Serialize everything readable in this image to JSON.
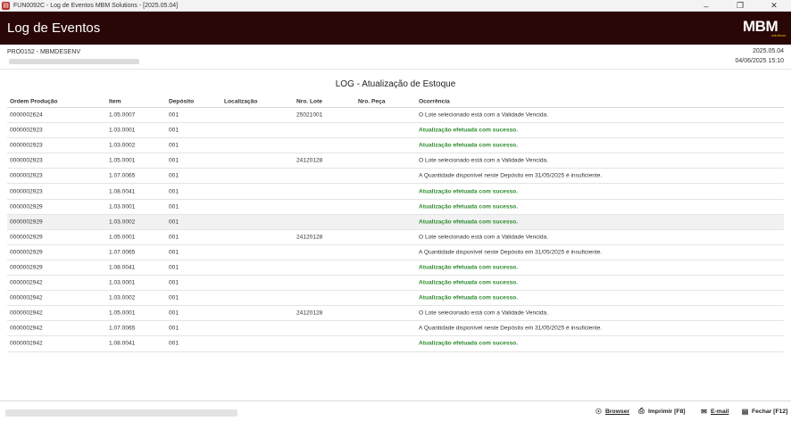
{
  "window": {
    "title": "FUN0092C - Log de Eventos MBM Solutions - [2025.05.04]",
    "icon": "app-icon",
    "controls": [
      "minimize",
      "maximize",
      "close"
    ]
  },
  "header": {
    "title": "Log de Eventos",
    "logo": "MBM",
    "logo_sub": "solutions",
    "bg_color": "#2a0707"
  },
  "info": {
    "program": "PRO0152 - MBMDESENV",
    "version": "2025.05.04",
    "datetime": "04/06/2025 15:10"
  },
  "report": {
    "title": "LOG - Atualização de Estoque"
  },
  "table": {
    "columns": {
      "ordem": "Ordem Produção",
      "item": "Item",
      "deposito": "Depósito",
      "localizacao": "Localização",
      "lote": "Nro. Lote",
      "peca": "Nro. Peça",
      "ocorrencia": "Ocorrência"
    },
    "rows": [
      {
        "ordem": "0000002624",
        "item": "1.05.0007",
        "deposito": "001",
        "localizacao": "",
        "lote": "25021001",
        "peca": "",
        "ocorrencia": "O Lote selecionado está com a Validade Vencida.",
        "status": "info"
      },
      {
        "ordem": "0000002923",
        "item": "1.03.0001",
        "deposito": "001",
        "localizacao": "",
        "lote": "",
        "peca": "",
        "ocorrencia": "Atualização efetuada com sucesso.",
        "status": "ok"
      },
      {
        "ordem": "0000002923",
        "item": "1.03.0002",
        "deposito": "001",
        "localizacao": "",
        "lote": "",
        "peca": "",
        "ocorrencia": "Atualização efetuada com sucesso.",
        "status": "ok"
      },
      {
        "ordem": "0000002923",
        "item": "1.05.0001",
        "deposito": "001",
        "localizacao": "",
        "lote": "24120128",
        "peca": "",
        "ocorrencia": "O Lote selecionado está com a Validade Vencida.",
        "status": "info"
      },
      {
        "ordem": "0000002923",
        "item": "1.07.0065",
        "deposito": "001",
        "localizacao": "",
        "lote": "",
        "peca": "",
        "ocorrencia": "A Quantidade disponível neste Depósito em 31/05/2025 é insuficiente.",
        "status": "info"
      },
      {
        "ordem": "0000002923",
        "item": "1.08.0041",
        "deposito": "001",
        "localizacao": "",
        "lote": "",
        "peca": "",
        "ocorrencia": "Atualização efetuada com sucesso.",
        "status": "ok"
      },
      {
        "ordem": "0000002929",
        "item": "1.03.0001",
        "deposito": "001",
        "localizacao": "",
        "lote": "",
        "peca": "",
        "ocorrencia": "Atualização efetuada com sucesso.",
        "status": "ok"
      },
      {
        "ordem": "0000002929",
        "item": "1.03.0002",
        "deposito": "001",
        "localizacao": "",
        "lote": "",
        "peca": "",
        "ocorrencia": "Atualização efetuada com sucesso.",
        "status": "ok",
        "highlight": true
      },
      {
        "ordem": "0000002929",
        "item": "1.05.0001",
        "deposito": "001",
        "localizacao": "",
        "lote": "24120128",
        "peca": "",
        "ocorrencia": "O Lote selecionado está com a Validade Vencida.",
        "status": "info"
      },
      {
        "ordem": "0000002929",
        "item": "1.07.0065",
        "deposito": "001",
        "localizacao": "",
        "lote": "",
        "peca": "",
        "ocorrencia": "A Quantidade disponível neste Depósito em 31/05/2025 é insuficiente.",
        "status": "info"
      },
      {
        "ordem": "0000002929",
        "item": "1.08.0041",
        "deposito": "001",
        "localizacao": "",
        "lote": "",
        "peca": "",
        "ocorrencia": "Atualização efetuada com sucesso.",
        "status": "ok"
      },
      {
        "ordem": "0000002942",
        "item": "1.03.0001",
        "deposito": "001",
        "localizacao": "",
        "lote": "",
        "peca": "",
        "ocorrencia": "Atualização efetuada com sucesso.",
        "status": "ok"
      },
      {
        "ordem": "0000002942",
        "item": "1.03.0002",
        "deposito": "001",
        "localizacao": "",
        "lote": "",
        "peca": "",
        "ocorrencia": "Atualização efetuada com sucesso.",
        "status": "ok"
      },
      {
        "ordem": "0000002942",
        "item": "1.05.0001",
        "deposito": "001",
        "localizacao": "",
        "lote": "24120128",
        "peca": "",
        "ocorrencia": "O Lote selecionado está com a Validade Vencida.",
        "status": "info"
      },
      {
        "ordem": "0000002942",
        "item": "1.07.0065",
        "deposito": "001",
        "localizacao": "",
        "lote": "",
        "peca": "",
        "ocorrencia": "A Quantidade disponível neste Depósito em 31/05/2025 é insuficiente.",
        "status": "info"
      },
      {
        "ordem": "0000002942",
        "item": "1.08.0041",
        "deposito": "001",
        "localizacao": "",
        "lote": "",
        "peca": "",
        "ocorrencia": "Atualização efetuada com sucesso.",
        "status": "ok"
      }
    ],
    "ok_color": "#2e8b2e"
  },
  "footer": {
    "buttons": [
      {
        "label": "Browser",
        "icon": "globe-icon",
        "name": "browser-button"
      },
      {
        "label": "Imprimir [F8]",
        "icon": "printer-icon",
        "name": "print-button"
      },
      {
        "label": "E-mail",
        "icon": "email-icon",
        "name": "email-button"
      },
      {
        "label": "Fechar [F12]",
        "icon": "close-door-icon",
        "name": "close-report-button"
      }
    ]
  }
}
